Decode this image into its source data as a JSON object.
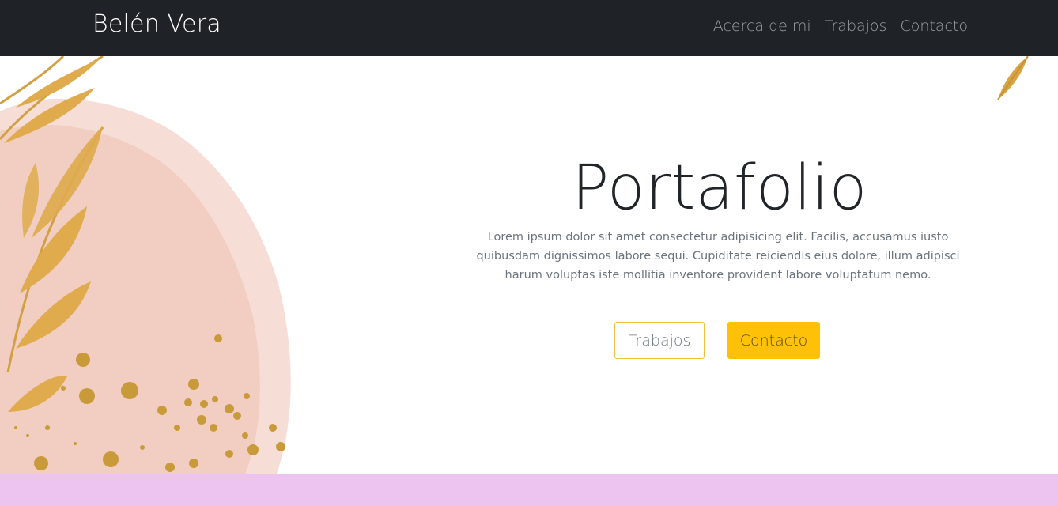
{
  "navbar": {
    "brand": "Belén Vera",
    "links": [
      {
        "label": "Acerca de mi"
      },
      {
        "label": "Trabajos"
      },
      {
        "label": "Contacto"
      }
    ]
  },
  "hero": {
    "title": "Portafolio",
    "lead": "Lorem ipsum dolor sit amet consectetur adipisicing elit. Facilis, accusamus iusto quibusdam dignissimos labore sequi. Cupiditate reiciendis eius dolore, illum adipisci harum voluptas iste mollitia inventore provident labore voluptatum nemo.",
    "buttons": {
      "primary_outline": "Trabajos",
      "primary_solid": "Contacto"
    }
  },
  "colors": {
    "navbar_bg": "#1f2226",
    "accent": "#ffc107",
    "footer_band": "#ecc4ef",
    "watercolor": "#f3d2c8",
    "leaf_gold": "#d9a540"
  },
  "icons": {
    "decoration": "watercolor-leaf-illustration"
  }
}
